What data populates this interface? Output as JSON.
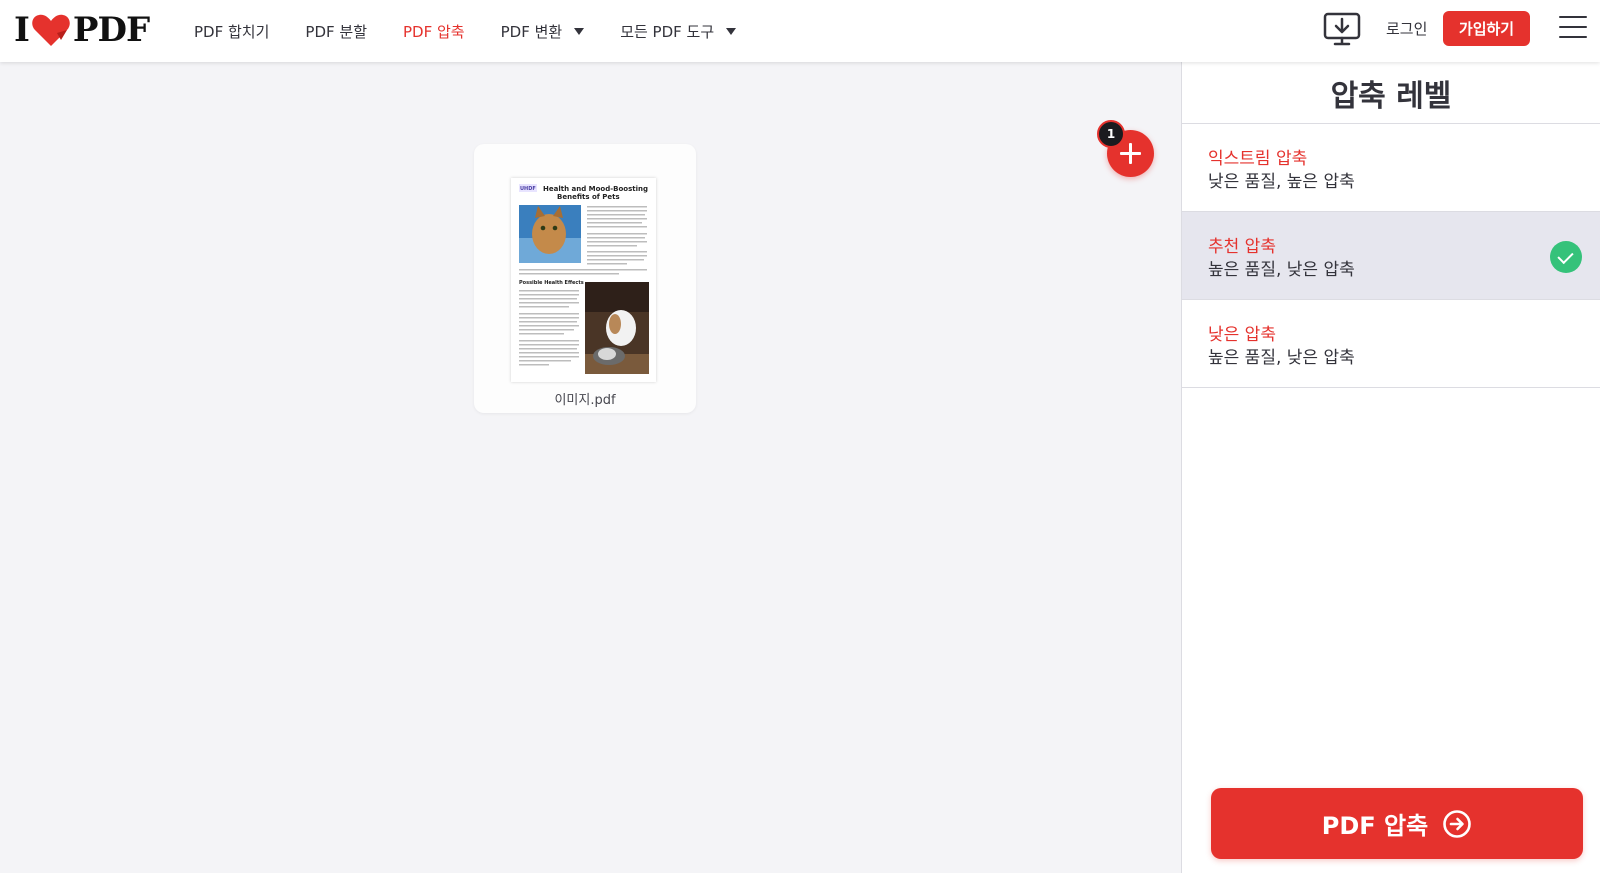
{
  "header": {
    "logo": {
      "left": "I",
      "right": "PDF"
    },
    "nav": [
      {
        "label": "PDF 합치기",
        "active": false,
        "dropdown": false
      },
      {
        "label": "PDF 분할",
        "active": false,
        "dropdown": false
      },
      {
        "label": "PDF 압축",
        "active": true,
        "dropdown": false
      },
      {
        "label": "PDF 변환",
        "active": false,
        "dropdown": true
      },
      {
        "label": "모든 PDF 도구",
        "active": false,
        "dropdown": true
      }
    ],
    "desktop_icon": "desktop-download-icon",
    "login_label": "로그인",
    "signup_label": "가입하기",
    "menu_icon": "hamburger-menu-icon"
  },
  "workspace": {
    "file": {
      "name": "이미지.pdf",
      "thumbnail_title": "Health and Mood-Boosting Benefits of Pets",
      "thumbnail_subhead": "Possible Health Effects"
    },
    "add_files_badge": "1"
  },
  "sidebar": {
    "title": "압축 레벨",
    "options": [
      {
        "title": "익스트림 압축",
        "desc": "낮은 품질, 높은 압축",
        "selected": false
      },
      {
        "title": "추천 압축",
        "desc": "높은 품질, 낮은 압축",
        "selected": true
      },
      {
        "title": "낮은 압축",
        "desc": "높은 품질, 낮은 압축",
        "selected": false
      }
    ],
    "action_label": "PDF 압축"
  },
  "colors": {
    "accent": "#e5322d",
    "check": "#35c27a",
    "selected_bg": "#e6e6ee",
    "workspace_bg": "#f4f4f7"
  }
}
